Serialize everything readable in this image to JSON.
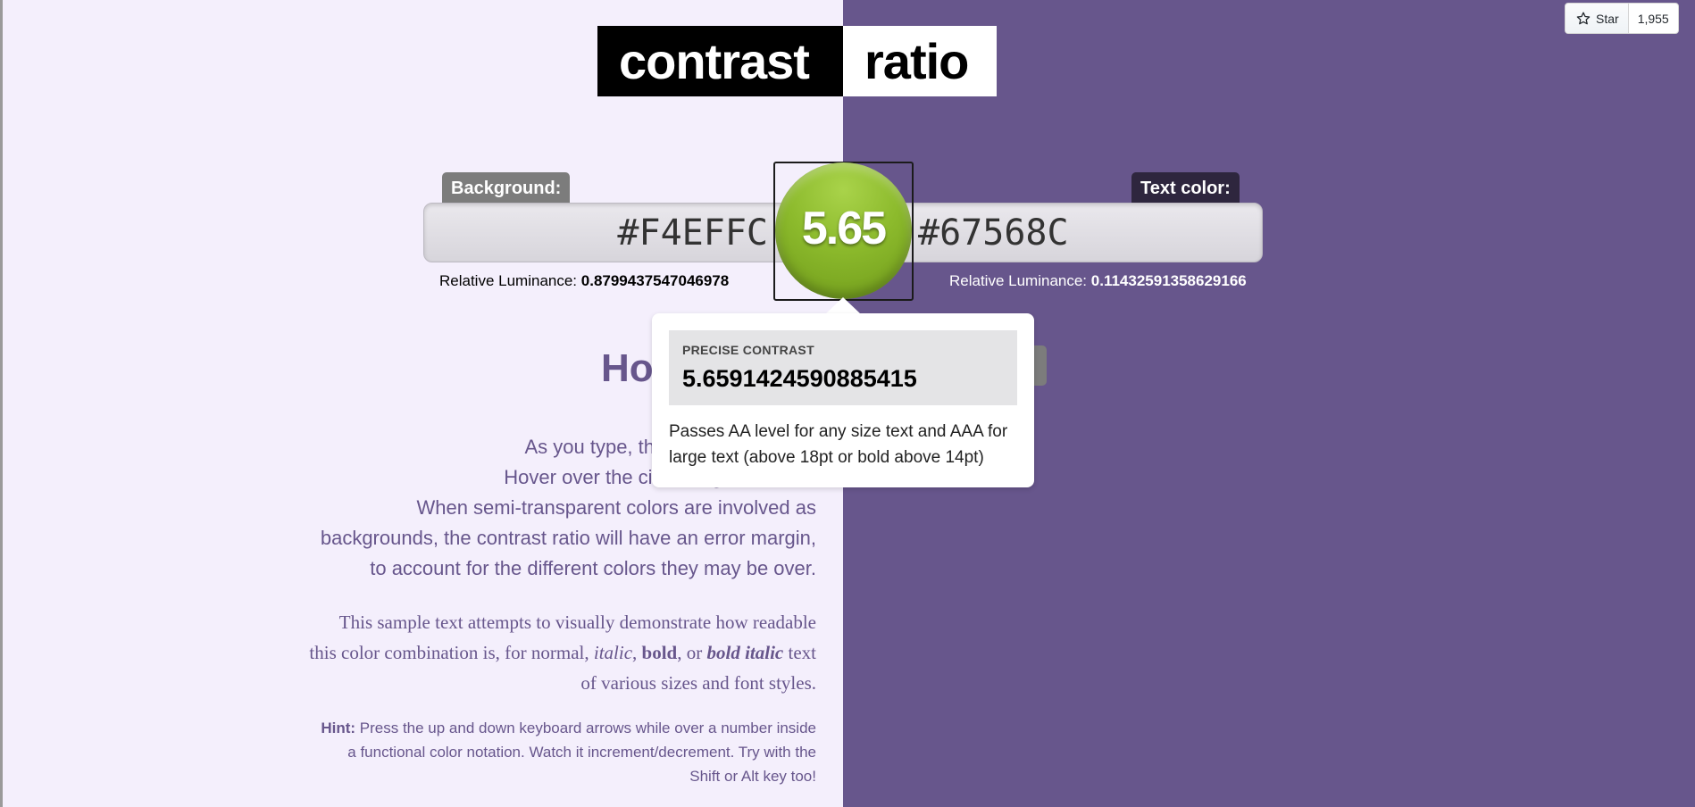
{
  "title": {
    "part1": "contrast",
    "part2": "ratio"
  },
  "github": {
    "star_label": "Star",
    "count": "1,955"
  },
  "colors": {
    "background": "#F4EFFC",
    "text": "#67568C",
    "badge_green": "#8cba2c"
  },
  "background": {
    "label": "Background:",
    "value": "#F4EFFC",
    "lum_label": "Relative Luminance:",
    "luminance": "0.8799437547046978"
  },
  "foreground": {
    "label": "Text color:",
    "value": "#67568C",
    "lum_label": "Relative Luminance:",
    "luminance": "0.11432591358629166"
  },
  "ratio": {
    "value": "5.65"
  },
  "tooltip": {
    "caption": "PRECISE CONTRAST",
    "precise": "5.6591424590885415",
    "line1": "Passes AA level for any size text and AAA for",
    "line2": "large text (above 18pt or bold above 14pt)"
  },
  "heading": "Ho",
  "intro": {
    "line1": "As you type, the contrast ratio ind",
    "line2": "Hover over the circle to get more de",
    "line3": "When semi-transparent colors are involved as",
    "line4": "backgrounds, the contrast ratio will have an error margin,",
    "line5": "to account for the different colors they may be over."
  },
  "sample": {
    "l1": "This sample text attempts to visually demonstrate how readable",
    "l2a": "this color combination is, for normal, ",
    "l2_italic": "italic",
    "l2b": ", ",
    "l2_bold": "bold",
    "l2c": ", or ",
    "l2_bolditalic": "bold italic",
    "l2d": " text",
    "l3": "of various sizes and font styles."
  },
  "hint": {
    "label": "Hint:",
    "line1": " Press the up and down keyboard arrows while over a number inside",
    "line2": "a functional color notation. Watch it increment/decrement. Try with the",
    "line3": "Shift or Alt key too!"
  }
}
